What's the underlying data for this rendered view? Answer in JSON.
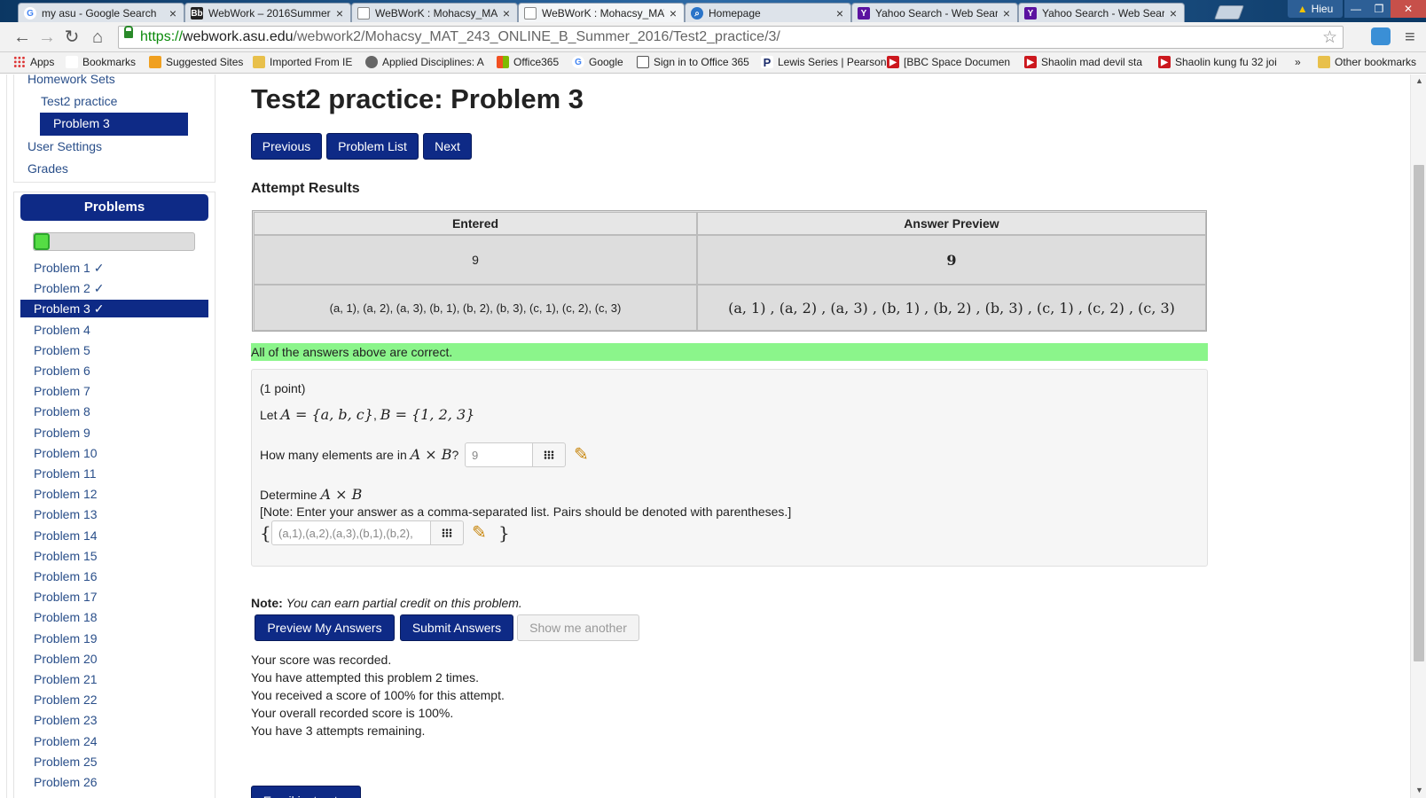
{
  "browser": {
    "tabs": [
      {
        "title": "my asu - Google Search",
        "icon": "google-icon",
        "active": false
      },
      {
        "title": "WebWork – 2016Summer",
        "icon": "blackboard-icon",
        "active": false
      },
      {
        "title": "WeBWorK : Mohacsy_MA",
        "icon": "page-icon",
        "active": false
      },
      {
        "title": "WeBWorK : Mohacsy_MAT",
        "icon": "page-icon",
        "active": true
      },
      {
        "title": "Homepage",
        "icon": "search-icon",
        "active": false
      },
      {
        "title": "Yahoo Search - Web Sear",
        "icon": "yahoo-icon",
        "active": false
      },
      {
        "title": "Yahoo Search - Web Sear",
        "icon": "yahoo-icon",
        "active": false
      }
    ],
    "profile_name": "Hieu",
    "url_scheme": "https://",
    "url_host": "webwork.asu.edu",
    "url_path": "/webwork2/Mohacsy_MAT_243_ONLINE_B_Summer_2016/Test2_practice/3/",
    "bookmarks": [
      {
        "label": "Apps",
        "icon": "apps-icon"
      },
      {
        "label": "Bookmarks",
        "icon": "folder-icon"
      },
      {
        "label": "Suggested Sites",
        "icon": "suggested-icon"
      },
      {
        "label": "Imported From IE",
        "icon": "folder-icon"
      },
      {
        "label": "Applied Disciplines: A",
        "icon": "globe-icon"
      },
      {
        "label": "Office365",
        "icon": "office-icon"
      },
      {
        "label": "Google",
        "icon": "google-icon"
      },
      {
        "label": "Sign in to Office 365",
        "icon": "signin-icon"
      },
      {
        "label": "Lewis Series | Pearson",
        "icon": "pearson-icon"
      },
      {
        "label": "[BBC Space Documen",
        "icon": "youtube-icon"
      },
      {
        "label": "Shaolin mad devil sta",
        "icon": "youtube-icon"
      },
      {
        "label": "Shaolin kung fu 32 joi",
        "icon": "youtube-icon"
      },
      {
        "label": "»",
        "icon": "overflow-icon"
      },
      {
        "label": "Other bookmarks",
        "icon": "folder-icon"
      }
    ]
  },
  "sidebar": {
    "homework_sets": "Homework Sets",
    "set_name": "Test2 practice",
    "current_problem": "Problem 3",
    "user_settings": "User Settings",
    "grades": "Grades",
    "problems_header": "Problems",
    "progress_fraction": 0.09,
    "problems": [
      "Problem 1 ✓",
      "Problem 2 ✓",
      "Problem 3 ✓",
      "Problem 4",
      "Problem 5",
      "Problem 6",
      "Problem 7",
      "Problem 8",
      "Problem 9",
      "Problem 10",
      "Problem 11",
      "Problem 12",
      "Problem 13",
      "Problem 14",
      "Problem 15",
      "Problem 16",
      "Problem 17",
      "Problem 18",
      "Problem 19",
      "Problem 20",
      "Problem 21",
      "Problem 22",
      "Problem 23",
      "Problem 24",
      "Problem 25",
      "Problem 26"
    ],
    "selected_index": 2
  },
  "main": {
    "title": "Test2 practice: Problem 3",
    "nav": {
      "previous": "Previous",
      "problem_list": "Problem List",
      "next": "Next"
    },
    "attempt_results_header": "Attempt Results",
    "results": {
      "col_entered": "Entered",
      "col_preview": "Answer Preview",
      "rows": [
        {
          "entered": "9",
          "preview": "9"
        },
        {
          "entered": "(a, 1), (a, 2), (a, 3), (b, 1), (b, 2), (b, 3), (c, 1), (c, 2), (c, 3)",
          "preview": "(a, 1) , (a, 2) , (a, 3) , (b, 1) , (b, 2) , (b, 3) , (c, 1) , (c, 2) , (c, 3)"
        }
      ]
    },
    "correct_message": "All of the answers above are correct.",
    "problem": {
      "points": "(1 point)",
      "let_prefix": "Let",
      "def_A": "A = {a, b, c}",
      "def_sep": ",",
      "def_B": "B = {1, 2, 3}",
      "q1_prefix": "How many elements are in",
      "q1_math": "A × B",
      "q1_suffix": "?",
      "q1_value": "9",
      "q2_prefix": "Determine",
      "q2_math": "A × B",
      "q2_note": "[Note: Enter your answer as a comma-separated list. Pairs should be denoted with parentheses.]",
      "brace_open": "{",
      "q2_value": "(a,1),(a,2),(a,3),(b,1),(b,2),",
      "brace_close": "}"
    },
    "note_label": "Note:",
    "note_text": "You can earn partial credit on this problem.",
    "actions": {
      "preview": "Preview My Answers",
      "submit": "Submit Answers",
      "show_another": "Show me another"
    },
    "status_lines": [
      "Your score was recorded.",
      "You have attempted this problem 2 times.",
      "You received a score of 100% for this attempt.",
      "Your overall recorded score is 100%.",
      "You have 3 attempts remaining."
    ],
    "email_button": "Email instructor"
  },
  "colors": {
    "primary": "#0e2a86",
    "success": "#8bf58b",
    "progress": "#55dd44"
  }
}
